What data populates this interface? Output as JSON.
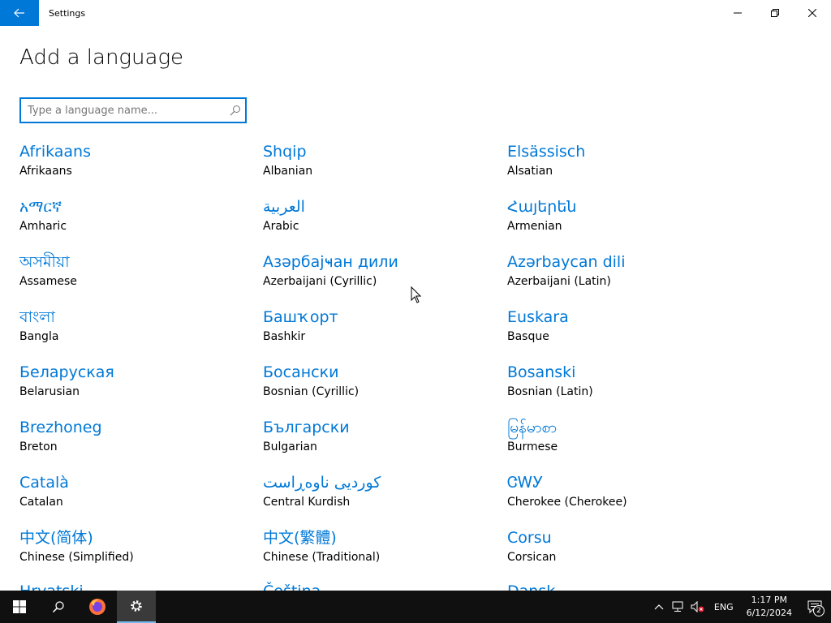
{
  "window": {
    "title": "Settings"
  },
  "page": {
    "title": "Add a language"
  },
  "search": {
    "placeholder": "Type a language name..."
  },
  "languages": [
    {
      "native": "Afrikaans",
      "english": "Afrikaans"
    },
    {
      "native": "Shqip",
      "english": "Albanian"
    },
    {
      "native": "Elsässisch",
      "english": "Alsatian"
    },
    {
      "native": "አማርኛ",
      "english": "Amharic"
    },
    {
      "native": "العربية",
      "english": "Arabic"
    },
    {
      "native": "Հայերեն",
      "english": "Armenian"
    },
    {
      "native": "অসমীয়া",
      "english": "Assamese"
    },
    {
      "native": "Азәрбајҹан дили",
      "english": "Azerbaijani (Cyrillic)"
    },
    {
      "native": "Azərbaycan dili",
      "english": "Azerbaijani (Latin)"
    },
    {
      "native": "বাংলা",
      "english": "Bangla"
    },
    {
      "native": "Башҡорт",
      "english": "Bashkir"
    },
    {
      "native": "Euskara",
      "english": "Basque"
    },
    {
      "native": "Беларуская",
      "english": "Belarusian"
    },
    {
      "native": "Босански",
      "english": "Bosnian (Cyrillic)"
    },
    {
      "native": "Bosanski",
      "english": "Bosnian (Latin)"
    },
    {
      "native": "Brezhoneg",
      "english": "Breton"
    },
    {
      "native": "Български",
      "english": "Bulgarian"
    },
    {
      "native": "မြန်မာစာ",
      "english": "Burmese"
    },
    {
      "native": "Català",
      "english": "Catalan"
    },
    {
      "native": "کوردیی ناوەڕاست",
      "english": "Central Kurdish"
    },
    {
      "native": "ᏣᎳᎩ",
      "english": "Cherokee (Cherokee)"
    },
    {
      "native": "中文(简体)",
      "english": "Chinese (Simplified)"
    },
    {
      "native": "中文(繁體)",
      "english": "Chinese (Traditional)"
    },
    {
      "native": "Corsu",
      "english": "Corsican"
    },
    {
      "native": "Hrvatski",
      "english": ""
    },
    {
      "native": "Čeština",
      "english": ""
    },
    {
      "native": "Dansk",
      "english": ""
    }
  ],
  "taskbar": {
    "items": [
      {
        "name": "start-button",
        "icon": "windows-logo-icon"
      },
      {
        "name": "search-button",
        "icon": "search-icon"
      },
      {
        "name": "firefox-button",
        "icon": "firefox-icon"
      },
      {
        "name": "settings-taskbar-button",
        "icon": "gear-icon"
      }
    ],
    "language": "ENG",
    "time": "1:17 PM",
    "date": "6/12/2024",
    "notification_count": "2"
  },
  "colors": {
    "accent": "#0078d7",
    "taskbar": "#101010"
  }
}
